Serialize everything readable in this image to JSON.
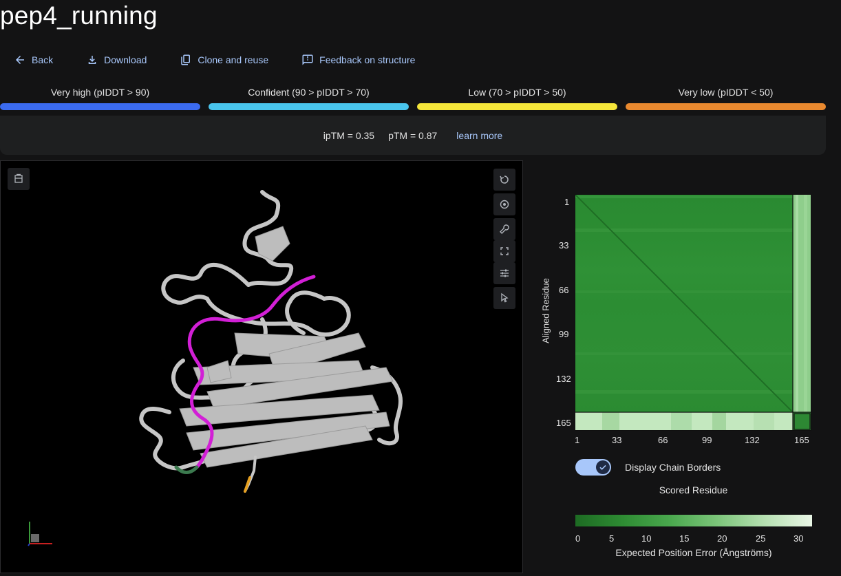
{
  "page": {
    "title": "pep4_running"
  },
  "toolbar": {
    "back_label": "Back",
    "download_label": "Download",
    "clone_label": "Clone and reuse",
    "feedback_label": "Feedback on structure"
  },
  "confidence_legend": [
    {
      "label": "Very high (pIDDT > 90)",
      "color": "#3b6bf0"
    },
    {
      "label": "Confident (90 > pIDDT > 70)",
      "color": "#49c5ed"
    },
    {
      "label": "Low (70 > pIDDT > 50)",
      "color": "#f5e63a"
    },
    {
      "label": "Very low (pIDDT < 50)",
      "color": "#e9892f"
    }
  ],
  "metrics": {
    "iptm": "ipTM = 0.35",
    "ptm": "pTM = 0.87",
    "learn_more": "learn more"
  },
  "viewer": {
    "tools": [
      "reset-view-icon",
      "camera-icon",
      "wrench-icon",
      "fullscreen-icon",
      "settings-sliders-icon",
      "select-cursor-icon"
    ],
    "left_tool": "controls-panel-icon"
  },
  "pae": {
    "y_axis_label": "Aligned Residue",
    "x_axis_label": "Scored Residue",
    "y_ticks": [
      "1",
      "33",
      "66",
      "99",
      "132",
      "165"
    ],
    "x_ticks": [
      "1",
      "33",
      "66",
      "99",
      "132",
      "165"
    ],
    "toggle_label": "Display Chain Borders",
    "toggle_on": true,
    "colorbar_ticks": [
      "0",
      "5",
      "10",
      "15",
      "20",
      "25",
      "30"
    ],
    "colorbar_label": "Expected Position Error (Ångströms)"
  }
}
